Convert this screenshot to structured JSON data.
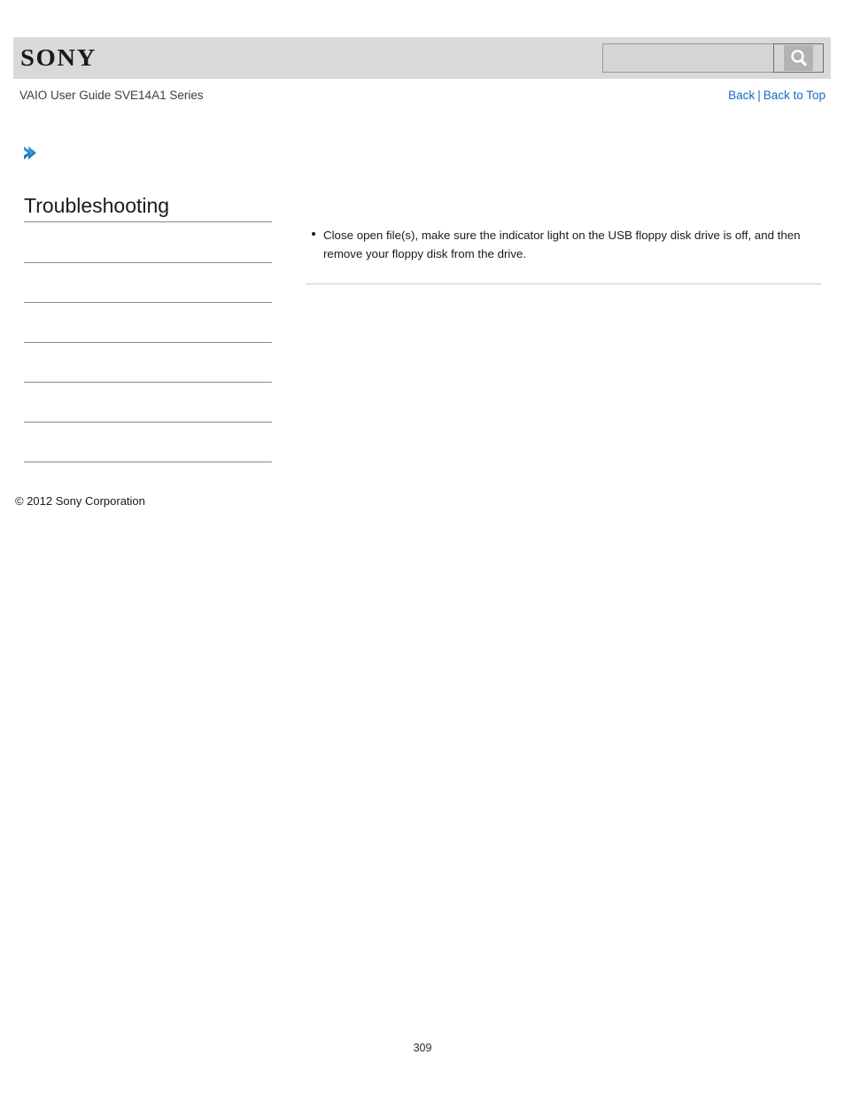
{
  "header": {
    "logo_text": "SONY",
    "background_color": "#d9d9d9"
  },
  "search": {
    "value": "",
    "placeholder": "",
    "icon": "search-icon",
    "button_label": ""
  },
  "title_bar": {
    "guide_title": "VAIO User Guide SVE14A1 Series",
    "links": {
      "back": "Back",
      "separator": "|",
      "back_to_top": "Back to Top"
    },
    "link_color": "#1769c4"
  },
  "breadcrumb": {
    "chevron_icon": "chevron-right-icon",
    "chevron_color": "#2b87c8",
    "text": ""
  },
  "sidebar": {
    "heading": "Troubleshooting",
    "items": [
      {
        "label": ""
      },
      {
        "label": ""
      },
      {
        "label": ""
      },
      {
        "label": ""
      },
      {
        "label": ""
      },
      {
        "label": ""
      }
    ]
  },
  "main": {
    "bullets": [
      "Close open file(s), make sure the indicator light on the USB floppy disk drive is off, and then remove your floppy disk from the drive."
    ]
  },
  "footer": {
    "copyright": "© 2012 Sony Corporation",
    "page_number": "309"
  }
}
